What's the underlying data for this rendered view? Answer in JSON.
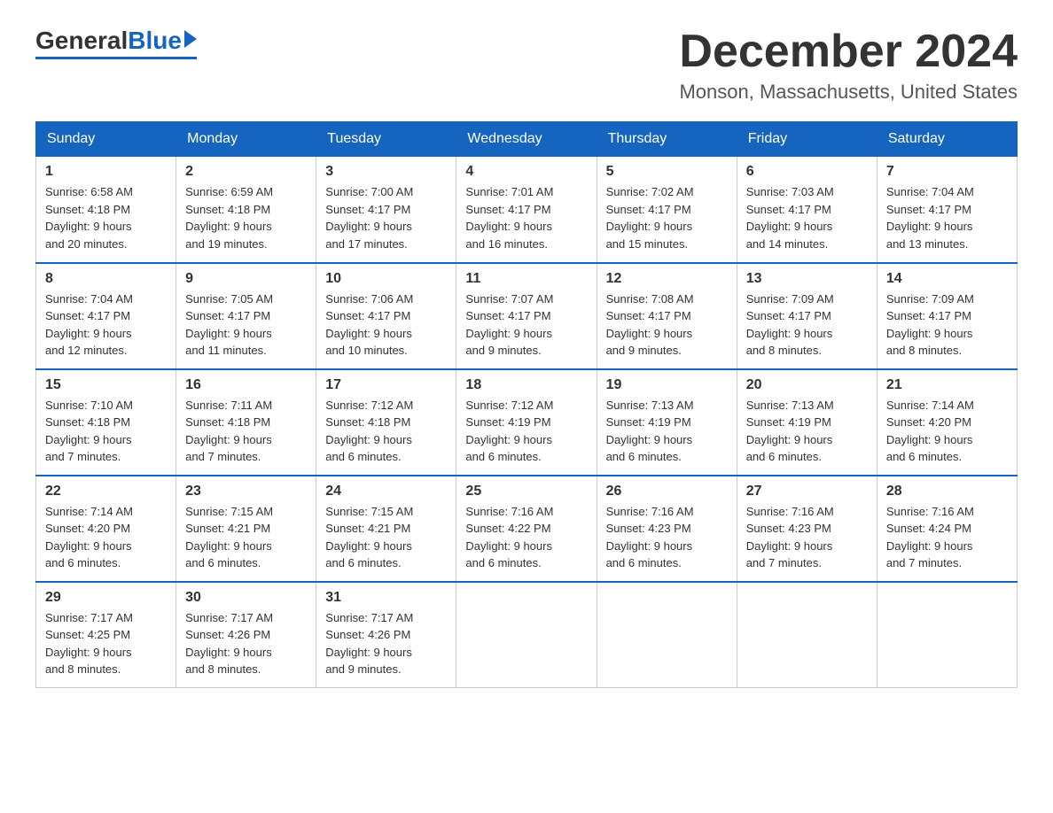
{
  "logo": {
    "general": "General",
    "blue": "Blue"
  },
  "title": {
    "month_year": "December 2024",
    "location": "Monson, Massachusetts, United States"
  },
  "days_of_week": [
    "Sunday",
    "Monday",
    "Tuesday",
    "Wednesday",
    "Thursday",
    "Friday",
    "Saturday"
  ],
  "weeks": [
    [
      {
        "day": "1",
        "sunrise": "6:58 AM",
        "sunset": "4:18 PM",
        "daylight": "9 hours and 20 minutes."
      },
      {
        "day": "2",
        "sunrise": "6:59 AM",
        "sunset": "4:18 PM",
        "daylight": "9 hours and 19 minutes."
      },
      {
        "day": "3",
        "sunrise": "7:00 AM",
        "sunset": "4:17 PM",
        "daylight": "9 hours and 17 minutes."
      },
      {
        "day": "4",
        "sunrise": "7:01 AM",
        "sunset": "4:17 PM",
        "daylight": "9 hours and 16 minutes."
      },
      {
        "day": "5",
        "sunrise": "7:02 AM",
        "sunset": "4:17 PM",
        "daylight": "9 hours and 15 minutes."
      },
      {
        "day": "6",
        "sunrise": "7:03 AM",
        "sunset": "4:17 PM",
        "daylight": "9 hours and 14 minutes."
      },
      {
        "day": "7",
        "sunrise": "7:04 AM",
        "sunset": "4:17 PM",
        "daylight": "9 hours and 13 minutes."
      }
    ],
    [
      {
        "day": "8",
        "sunrise": "7:04 AM",
        "sunset": "4:17 PM",
        "daylight": "9 hours and 12 minutes."
      },
      {
        "day": "9",
        "sunrise": "7:05 AM",
        "sunset": "4:17 PM",
        "daylight": "9 hours and 11 minutes."
      },
      {
        "day": "10",
        "sunrise": "7:06 AM",
        "sunset": "4:17 PM",
        "daylight": "9 hours and 10 minutes."
      },
      {
        "day": "11",
        "sunrise": "7:07 AM",
        "sunset": "4:17 PM",
        "daylight": "9 hours and 9 minutes."
      },
      {
        "day": "12",
        "sunrise": "7:08 AM",
        "sunset": "4:17 PM",
        "daylight": "9 hours and 9 minutes."
      },
      {
        "day": "13",
        "sunrise": "7:09 AM",
        "sunset": "4:17 PM",
        "daylight": "9 hours and 8 minutes."
      },
      {
        "day": "14",
        "sunrise": "7:09 AM",
        "sunset": "4:17 PM",
        "daylight": "9 hours and 8 minutes."
      }
    ],
    [
      {
        "day": "15",
        "sunrise": "7:10 AM",
        "sunset": "4:18 PM",
        "daylight": "9 hours and 7 minutes."
      },
      {
        "day": "16",
        "sunrise": "7:11 AM",
        "sunset": "4:18 PM",
        "daylight": "9 hours and 7 minutes."
      },
      {
        "day": "17",
        "sunrise": "7:12 AM",
        "sunset": "4:18 PM",
        "daylight": "9 hours and 6 minutes."
      },
      {
        "day": "18",
        "sunrise": "7:12 AM",
        "sunset": "4:19 PM",
        "daylight": "9 hours and 6 minutes."
      },
      {
        "day": "19",
        "sunrise": "7:13 AM",
        "sunset": "4:19 PM",
        "daylight": "9 hours and 6 minutes."
      },
      {
        "day": "20",
        "sunrise": "7:13 AM",
        "sunset": "4:19 PM",
        "daylight": "9 hours and 6 minutes."
      },
      {
        "day": "21",
        "sunrise": "7:14 AM",
        "sunset": "4:20 PM",
        "daylight": "9 hours and 6 minutes."
      }
    ],
    [
      {
        "day": "22",
        "sunrise": "7:14 AM",
        "sunset": "4:20 PM",
        "daylight": "9 hours and 6 minutes."
      },
      {
        "day": "23",
        "sunrise": "7:15 AM",
        "sunset": "4:21 PM",
        "daylight": "9 hours and 6 minutes."
      },
      {
        "day": "24",
        "sunrise": "7:15 AM",
        "sunset": "4:21 PM",
        "daylight": "9 hours and 6 minutes."
      },
      {
        "day": "25",
        "sunrise": "7:16 AM",
        "sunset": "4:22 PM",
        "daylight": "9 hours and 6 minutes."
      },
      {
        "day": "26",
        "sunrise": "7:16 AM",
        "sunset": "4:23 PM",
        "daylight": "9 hours and 6 minutes."
      },
      {
        "day": "27",
        "sunrise": "7:16 AM",
        "sunset": "4:23 PM",
        "daylight": "9 hours and 7 minutes."
      },
      {
        "day": "28",
        "sunrise": "7:16 AM",
        "sunset": "4:24 PM",
        "daylight": "9 hours and 7 minutes."
      }
    ],
    [
      {
        "day": "29",
        "sunrise": "7:17 AM",
        "sunset": "4:25 PM",
        "daylight": "9 hours and 8 minutes."
      },
      {
        "day": "30",
        "sunrise": "7:17 AM",
        "sunset": "4:26 PM",
        "daylight": "9 hours and 8 minutes."
      },
      {
        "day": "31",
        "sunrise": "7:17 AM",
        "sunset": "4:26 PM",
        "daylight": "9 hours and 9 minutes."
      },
      null,
      null,
      null,
      null
    ]
  ],
  "labels": {
    "sunrise": "Sunrise:",
    "sunset": "Sunset:",
    "daylight": "Daylight: 9 hours"
  }
}
